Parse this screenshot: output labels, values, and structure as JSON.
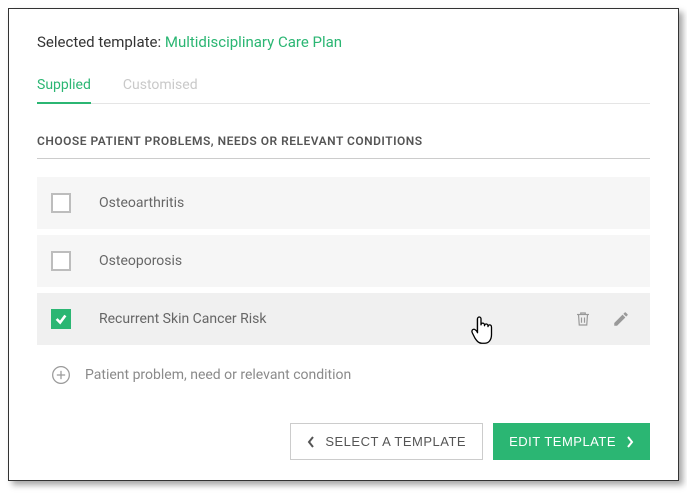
{
  "header": {
    "prefix": "Selected template:",
    "template_name": "Multidisciplinary Care Plan"
  },
  "tabs": {
    "supplied": "Supplied",
    "customised": "Customised"
  },
  "section": {
    "title": "CHOOSE PATIENT PROBLEMS, NEEDS OR RELEVANT CONDITIONS"
  },
  "problems": {
    "item0": "Osteoarthritis",
    "item1": "Osteoporosis",
    "item2": "Recurrent Skin Cancer Risk"
  },
  "add_row": {
    "label": "Patient problem, need or relevant condition"
  },
  "footer": {
    "select_label": "SELECT A TEMPLATE",
    "edit_label": "EDIT TEMPLATE"
  }
}
